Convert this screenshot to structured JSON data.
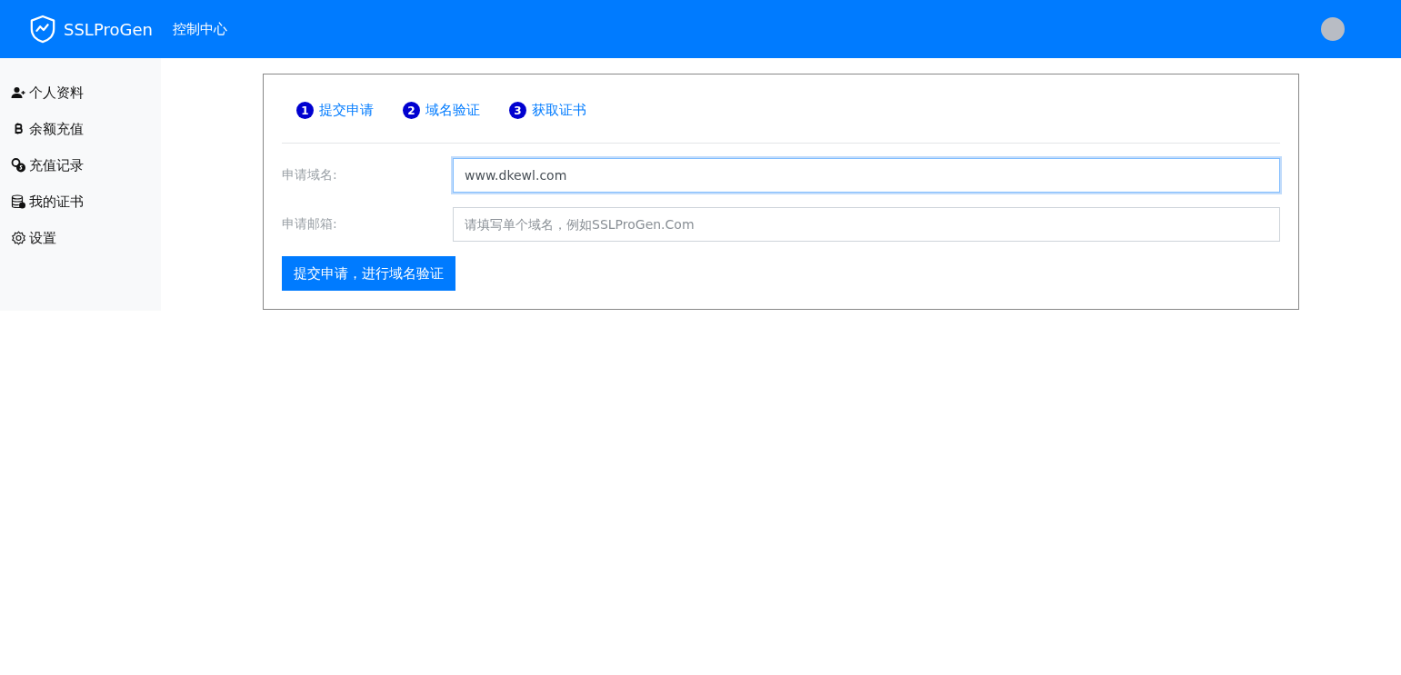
{
  "header": {
    "brand": "SSLProGen",
    "nav": [
      "控制中心"
    ]
  },
  "sidebar": {
    "items": [
      {
        "label": "个人资料",
        "kind": "user-plus"
      },
      {
        "label": "余额充值",
        "kind": "bitcoin"
      },
      {
        "label": "充值记录",
        "kind": "coins"
      },
      {
        "label": "我的证书",
        "kind": "database"
      },
      {
        "label": "设置",
        "kind": "gear"
      }
    ]
  },
  "steps": [
    {
      "number": "1",
      "label": "提交申请"
    },
    {
      "number": "2",
      "label": "域名验证"
    },
    {
      "number": "3",
      "label": "获取证书"
    }
  ],
  "form": {
    "fields": [
      {
        "label": "申请域名:",
        "value": "www.dkewl.com",
        "focused": true
      },
      {
        "label": "申请邮箱:",
        "placeholder": "请填写单个域名，例如SSLProGen.Com",
        "focused": false
      }
    ],
    "submit": "提交申请，进行域名验证"
  }
}
